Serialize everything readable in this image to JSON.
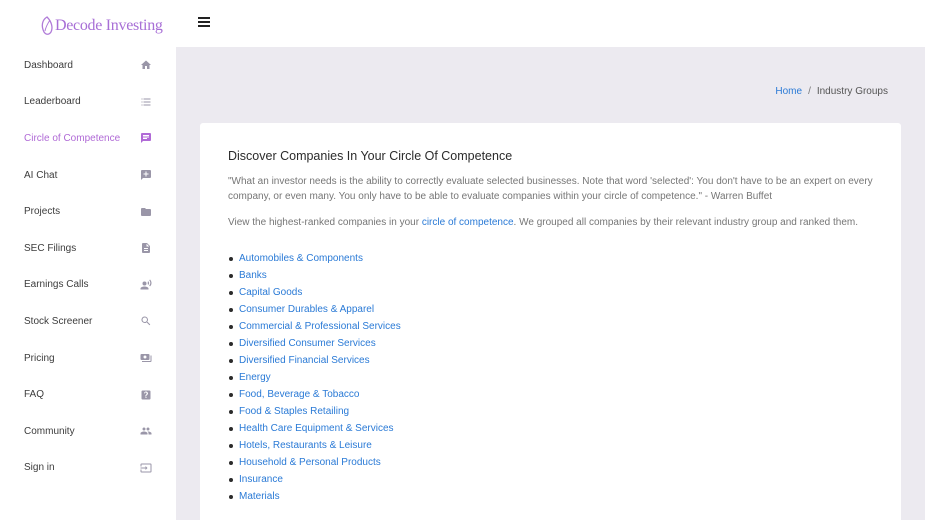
{
  "brand": {
    "name": "Decode Investing",
    "color": "#a86fd6"
  },
  "sidebar": {
    "items": [
      {
        "label": "Dashboard",
        "icon": "home-icon"
      },
      {
        "label": "Leaderboard",
        "icon": "list-icon"
      },
      {
        "label": "Circle of Competence",
        "icon": "message-icon",
        "active": true
      },
      {
        "label": "AI Chat",
        "icon": "chat-plus-icon"
      },
      {
        "label": "Projects",
        "icon": "folder-icon"
      },
      {
        "label": "SEC Filings",
        "icon": "document-icon"
      },
      {
        "label": "Earnings Calls",
        "icon": "speaker-person-icon"
      },
      {
        "label": "Stock Screener",
        "icon": "search-icon"
      },
      {
        "label": "Pricing",
        "icon": "money-icon"
      },
      {
        "label": "FAQ",
        "icon": "help-icon"
      },
      {
        "label": "Community",
        "icon": "people-icon"
      },
      {
        "label": "Sign in",
        "icon": "login-icon"
      }
    ]
  },
  "breadcrumb": {
    "home": "Home",
    "separator": "/",
    "current": "Industry Groups"
  },
  "content": {
    "title": "Discover Companies In Your Circle Of Competence",
    "quote": "\"What an investor needs is the ability to correctly evaluate selected businesses. Note that word 'selected': You don't have to be an expert on every company, or even many. You only have to be able to evaluate companies within your circle of competence.\" - Warren Buffet",
    "intro_before": "View the highest-ranked companies in your ",
    "intro_link": "circle of competence",
    "intro_after": ". We grouped all companies by their relevant industry group and ranked them.",
    "industry_groups": [
      "Automobiles & Components",
      "Banks",
      "Capital Goods",
      "Consumer Durables & Apparel",
      "Commercial & Professional Services",
      "Diversified Consumer Services",
      "Diversified Financial Services",
      "Energy",
      "Food, Beverage & Tobacco",
      "Food & Staples Retailing",
      "Health Care Equipment & Services",
      "Hotels, Restaurants & Leisure",
      "Household & Personal Products",
      "Insurance",
      "Materials"
    ]
  },
  "colors": {
    "accent": "#b06ad6",
    "link": "#2a7ad6",
    "background": "#eceaf0"
  }
}
